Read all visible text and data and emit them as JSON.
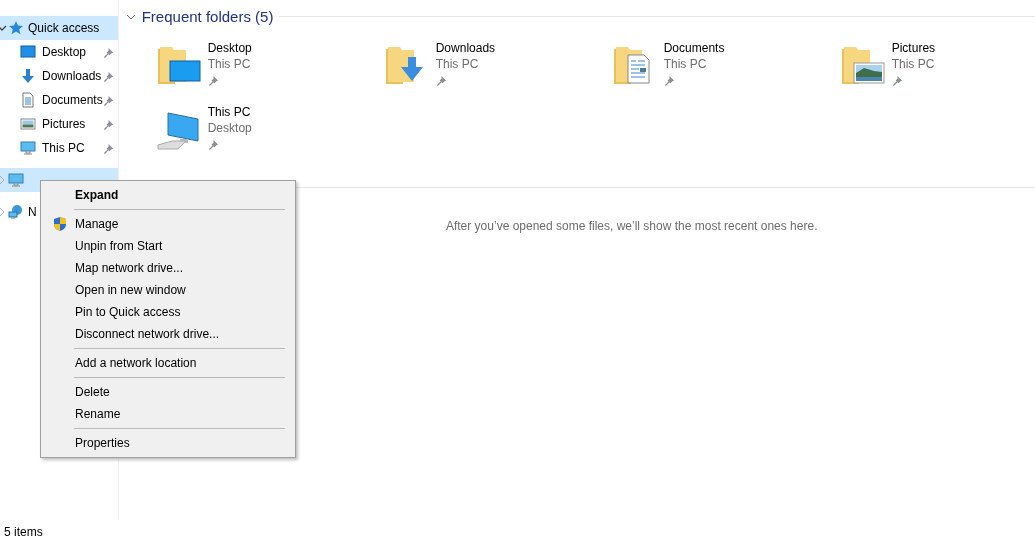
{
  "nav": [
    {
      "label": "Quick access",
      "kind": "star",
      "expanded": true,
      "selected": true,
      "children": [
        {
          "label": "Desktop",
          "kind": "desktop",
          "pinned": true
        },
        {
          "label": "Downloads",
          "kind": "downloads",
          "pinned": true
        },
        {
          "label": "Documents",
          "kind": "documents",
          "pinned": true
        },
        {
          "label": "Pictures",
          "kind": "pictures",
          "pinned": true
        },
        {
          "label": "This PC",
          "kind": "pc",
          "pinned": true
        }
      ]
    },
    {
      "kind": "pc",
      "expanded": false,
      "selected": true
    },
    {
      "label": "N",
      "kind": "network",
      "expanded": false,
      "selected": false
    }
  ],
  "section": {
    "title": "Frequent folders (5)",
    "expanded": true
  },
  "folders": [
    {
      "name": "Desktop",
      "location": "This PC",
      "kind": "desktop",
      "pinned": true
    },
    {
      "name": "Downloads",
      "location": "This PC",
      "kind": "downloads",
      "pinned": true
    },
    {
      "name": "Documents",
      "location": "This PC",
      "kind": "documents",
      "pinned": true
    },
    {
      "name": "Pictures",
      "location": "This PC",
      "kind": "pictures",
      "pinned": true
    },
    {
      "name": "This PC",
      "location": "Desktop",
      "kind": "pc",
      "pinned": true
    }
  ],
  "empty_message": "After you’ve opened some files, we’ll show the most recent ones here.",
  "context_menu": {
    "items": [
      {
        "label": "Expand",
        "kind": "default"
      },
      {
        "kind": "separator"
      },
      {
        "label": "Manage",
        "kind": "shield"
      },
      {
        "label": "Unpin from Start",
        "kind": "item"
      },
      {
        "label": "Map network drive...",
        "kind": "item"
      },
      {
        "label": "Open in new window",
        "kind": "item"
      },
      {
        "label": "Pin to Quick access",
        "kind": "item"
      },
      {
        "label": "Disconnect network drive...",
        "kind": "item"
      },
      {
        "kind": "separator"
      },
      {
        "label": "Add a network location",
        "kind": "item"
      },
      {
        "kind": "separator"
      },
      {
        "label": "Delete",
        "kind": "item"
      },
      {
        "label": "Rename",
        "kind": "item"
      },
      {
        "kind": "separator"
      },
      {
        "label": "Properties",
        "kind": "item"
      }
    ]
  },
  "status_bar": {
    "text": "5 items"
  }
}
